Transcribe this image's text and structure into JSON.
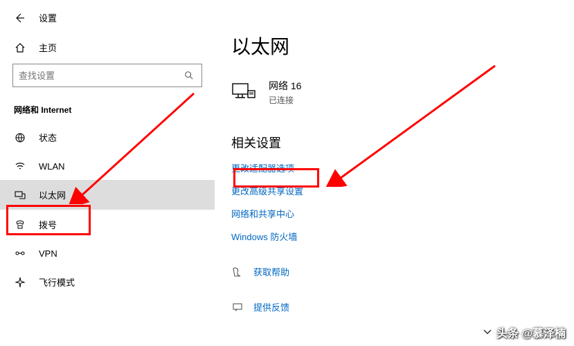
{
  "header": {
    "title": "设置"
  },
  "home": {
    "label": "主页"
  },
  "search": {
    "placeholder": "查找设置"
  },
  "category": {
    "label": "网络和 Internet"
  },
  "sidebar": {
    "items": [
      {
        "label": "状态"
      },
      {
        "label": "WLAN"
      },
      {
        "label": "以太网"
      },
      {
        "label": "拨号"
      },
      {
        "label": "VPN"
      },
      {
        "label": "飞行模式"
      }
    ]
  },
  "main": {
    "title": "以太网",
    "connection": {
      "name": "网络 16",
      "status": "已连接"
    },
    "related_label": "相关设置",
    "links": [
      "更改适配器选项",
      "更改高级共享设置",
      "网络和共享中心",
      "Windows 防火墙"
    ],
    "help": {
      "get_help": "获取帮助",
      "feedback": "提供反馈"
    }
  },
  "watermark": "头条 @慕泽楠"
}
